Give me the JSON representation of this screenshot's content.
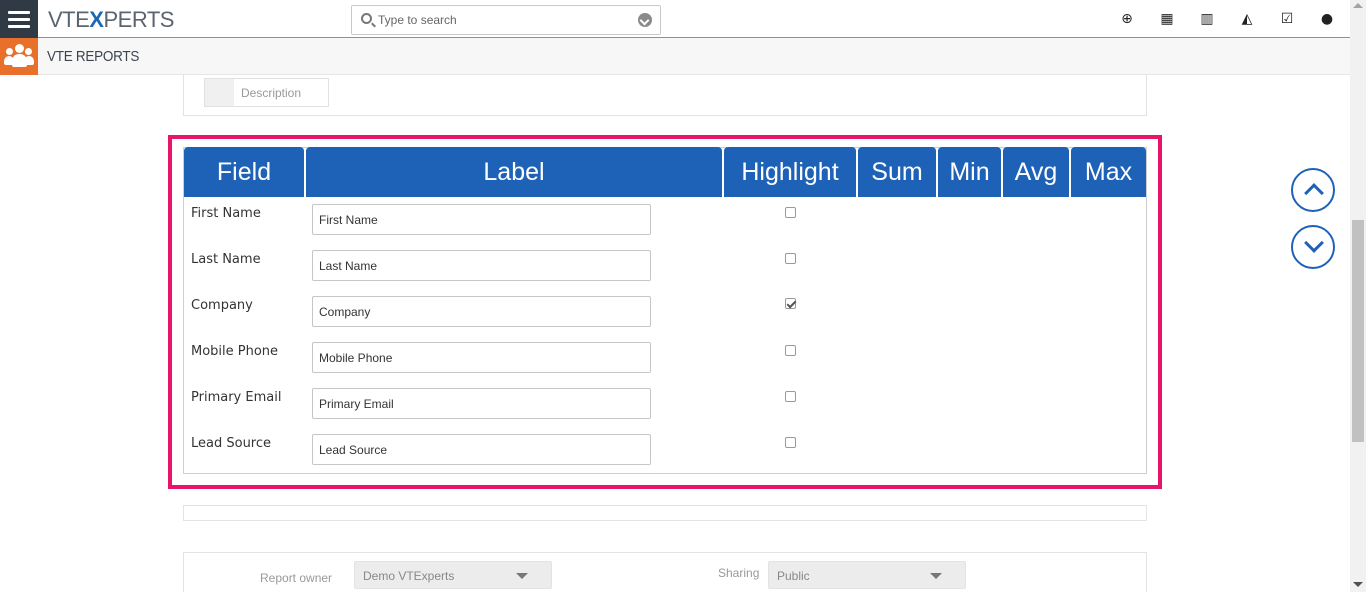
{
  "topbar": {
    "logo_prefix": "VTE",
    "logo_x": "X",
    "logo_suffix": "PERTS",
    "search_placeholder": "Type to search",
    "icons": [
      "plus-circle-icon",
      "calendar-icon",
      "bar-chart-icon",
      "area-chart-icon",
      "task-check-icon",
      "user-icon"
    ]
  },
  "module": {
    "title": "VTE REPORTS"
  },
  "description_chip": {
    "label": "Description"
  },
  "table": {
    "headers": {
      "field": "Field",
      "label": "Label",
      "highlight": "Highlight",
      "sum": "Sum",
      "min": "Min",
      "avg": "Avg",
      "max": "Max"
    },
    "rows": [
      {
        "field": "First Name",
        "label": "First Name",
        "highlight": false
      },
      {
        "field": "Last Name",
        "label": "Last Name",
        "highlight": false
      },
      {
        "field": "Company",
        "label": "Company",
        "highlight": true
      },
      {
        "field": "Mobile Phone",
        "label": "Mobile Phone",
        "highlight": false
      },
      {
        "field": "Primary Email",
        "label": "Primary Email",
        "highlight": false
      },
      {
        "field": "Lead Source",
        "label": "Lead Source",
        "highlight": false
      }
    ]
  },
  "owner": {
    "report_owner_label": "Report owner",
    "report_owner_value": "Demo VTExperts",
    "sharing_label": "Sharing",
    "sharing_value": "Public"
  },
  "colors": {
    "header_blue": "#1e62b8",
    "highlight_frame": "#e8146a",
    "accent_orange": "#e8702a"
  }
}
